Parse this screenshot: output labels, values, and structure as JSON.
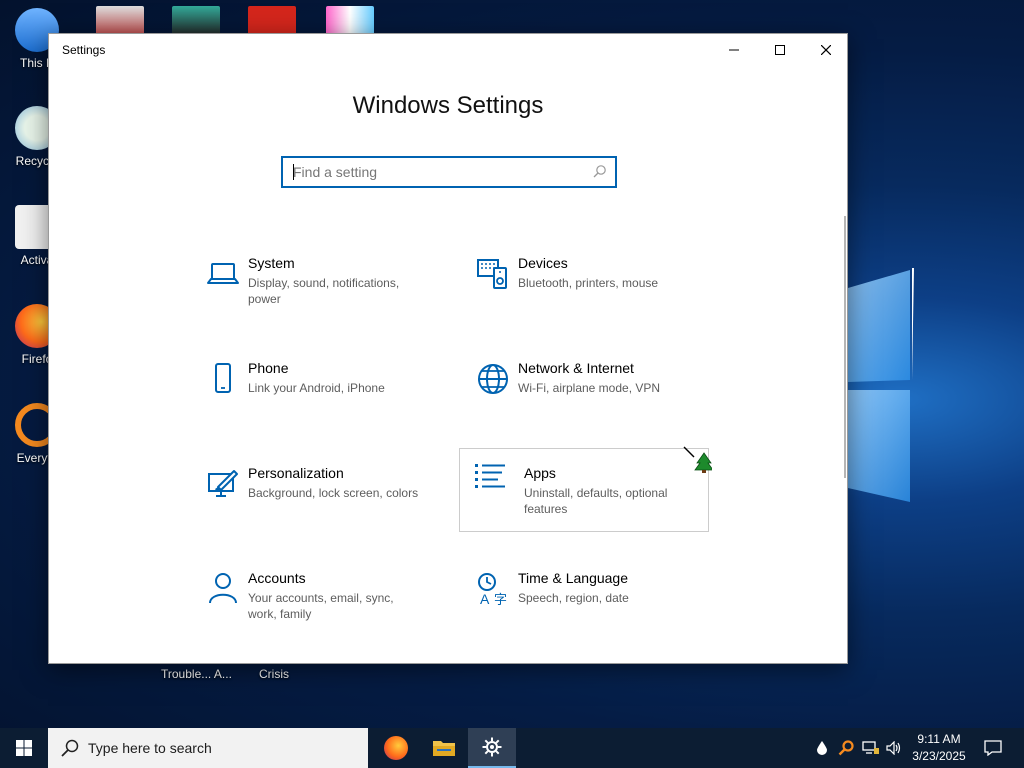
{
  "desktop": {
    "icons": [
      {
        "label": "This P"
      },
      {
        "label": "Recycle"
      },
      {
        "label": "Activa"
      },
      {
        "label": "Firefo"
      },
      {
        "label": "Everyth"
      }
    ],
    "behind_labels": [
      "Trouble... A...",
      "Crisis"
    ]
  },
  "window": {
    "title": "Settings",
    "heading": "Windows Settings",
    "search_placeholder": "Find a setting",
    "tiles": [
      {
        "title": "System",
        "desc": "Display, sound, notifications, power",
        "icon": "laptop-icon"
      },
      {
        "title": "Devices",
        "desc": "Bluetooth, printers, mouse",
        "icon": "devices-icon"
      },
      {
        "title": "Phone",
        "desc": "Link your Android, iPhone",
        "icon": "phone-icon"
      },
      {
        "title": "Network & Internet",
        "desc": "Wi-Fi, airplane mode, VPN",
        "icon": "globe-icon"
      },
      {
        "title": "Personalization",
        "desc": "Background, lock screen, colors",
        "icon": "paint-icon"
      },
      {
        "title": "Apps",
        "desc": "Uninstall, defaults, optional features",
        "icon": "apps-list-icon"
      },
      {
        "title": "Accounts",
        "desc": "Your accounts, email, sync, work, family",
        "icon": "person-icon"
      },
      {
        "title": "Time & Language",
        "desc": "Speech, region, date",
        "icon": "time-language-icon"
      }
    ]
  },
  "taskbar": {
    "search_label": "Type here to search",
    "time": "9:11 AM",
    "date": "3/23/2025"
  },
  "colors": {
    "accent": "#0063b1",
    "taskbar": "#0c1d33",
    "search_box": "#f2f2f2"
  }
}
